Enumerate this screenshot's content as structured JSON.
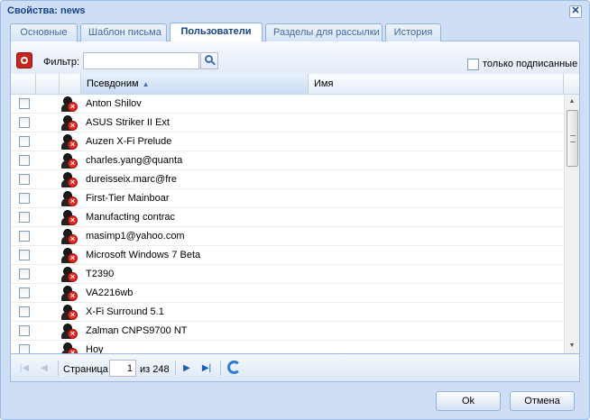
{
  "window": {
    "title": "Свойства: news"
  },
  "tabs": [
    {
      "label": "Основные"
    },
    {
      "label": "Шаблон письма"
    },
    {
      "label": "Пользователи"
    },
    {
      "label": "Разделы для рассылки"
    },
    {
      "label": "История"
    }
  ],
  "toolbar": {
    "filter_label": "Фильтр:",
    "filter_value": "",
    "subscribed_only_label": "только подписанные",
    "subscribed_only_checked": false
  },
  "grid": {
    "columns": [
      {
        "label": "Псевдоним",
        "sort": "asc"
      },
      {
        "label": "Имя"
      }
    ],
    "rows": [
      {
        "alias": "Anton Shilov",
        "name": ""
      },
      {
        "alias": "ASUS Striker II Ext",
        "name": ""
      },
      {
        "alias": "Auzen X-Fi Prelude",
        "name": ""
      },
      {
        "alias": "charles.yang@quanta",
        "name": ""
      },
      {
        "alias": "dureisseix.marc@fre",
        "name": ""
      },
      {
        "alias": "First-Tier Mainboar",
        "name": ""
      },
      {
        "alias": "Manufacting contrac",
        "name": ""
      },
      {
        "alias": "masimp1@yahoo.com",
        "name": ""
      },
      {
        "alias": "Microsoft Windows 7 Beta",
        "name": ""
      },
      {
        "alias": "T2390",
        "name": ""
      },
      {
        "alias": "VA2216wb",
        "name": ""
      },
      {
        "alias": "X-Fi Surround 5.1",
        "name": ""
      },
      {
        "alias": "Zalman CNPS9700 NT",
        "name": ""
      },
      {
        "alias": "Hoy",
        "name": ""
      }
    ]
  },
  "pager": {
    "page_label": "Страница",
    "current_page": "1",
    "of_label": "из 248"
  },
  "buttons": {
    "ok": "Ok",
    "cancel": "Отмена"
  },
  "colors": {
    "window_bg": "#cedff5",
    "title_text": "#15428b",
    "border": "#99bbe8",
    "user_disabled_badge": "#e8281e"
  }
}
